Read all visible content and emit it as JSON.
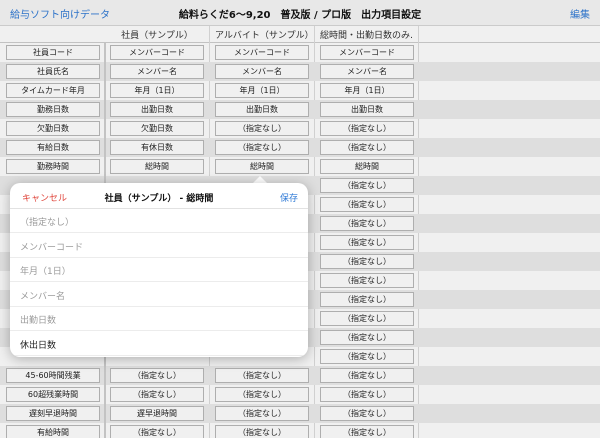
{
  "nav": {
    "back_label": "給与ソフト向けデータ",
    "title": "給料らくだ6～9,20　普及版 / プロ版　出力項目設定",
    "edit_label": "編集"
  },
  "columns": [
    "",
    "社員（サンプル）",
    "アルバイト（サンプル）",
    "総時間・出勤日数のみ…"
  ],
  "rows": [
    [
      "社員コード",
      "メンバーコード",
      "メンバーコード",
      "メンバーコード"
    ],
    [
      "社員氏名",
      "メンバー名",
      "メンバー名",
      "メンバー名"
    ],
    [
      "タイムカード年月",
      "年月（1日）",
      "年月（1日）",
      "年月（1日）"
    ],
    [
      "勤務日数",
      "出勤日数",
      "出勤日数",
      "出勤日数"
    ],
    [
      "欠勤日数",
      "欠勤日数",
      "（指定なし）",
      "（指定なし）"
    ],
    [
      "有給日数",
      "有休日数",
      "（指定なし）",
      "（指定なし）"
    ],
    [
      "勤務時間",
      "総時間",
      "総時間",
      "総時間"
    ],
    [
      "",
      "",
      "",
      "（指定なし）"
    ],
    [
      "",
      "",
      "",
      "（指定なし）"
    ],
    [
      "",
      "",
      "",
      "（指定なし）"
    ],
    [
      "",
      "",
      "",
      "（指定なし）"
    ],
    [
      "",
      "",
      "",
      "（指定なし）"
    ],
    [
      "",
      "",
      "",
      "（指定なし）"
    ],
    [
      "",
      "",
      "",
      "（指定なし）"
    ],
    [
      "",
      "",
      "",
      "（指定なし）"
    ],
    [
      "",
      "",
      "",
      "（指定なし）"
    ],
    [
      "",
      "",
      "",
      "（指定なし）"
    ],
    [
      "45-60時間残業",
      "（指定なし）",
      "（指定なし）",
      "（指定なし）"
    ],
    [
      "60超残業時間",
      "（指定なし）",
      "（指定なし）",
      "（指定なし）"
    ],
    [
      "遅刻早退時間",
      "遅早退時間",
      "（指定なし）",
      "（指定なし）"
    ],
    [
      "有給時間",
      "（指定なし）",
      "（指定なし）",
      "（指定なし）"
    ]
  ],
  "popover": {
    "cancel_label": "キャンセル",
    "title": "社員（サンプル） - 総時間",
    "save_label": "保存",
    "options": [
      "（指定なし）",
      "メンバーコード",
      "年月（1日）",
      "メンバー名",
      "出勤日数",
      "休出日数"
    ],
    "selected_index": 5
  },
  "colors": {
    "accent": "#2f7ad6",
    "cancel": "#e0483e"
  }
}
